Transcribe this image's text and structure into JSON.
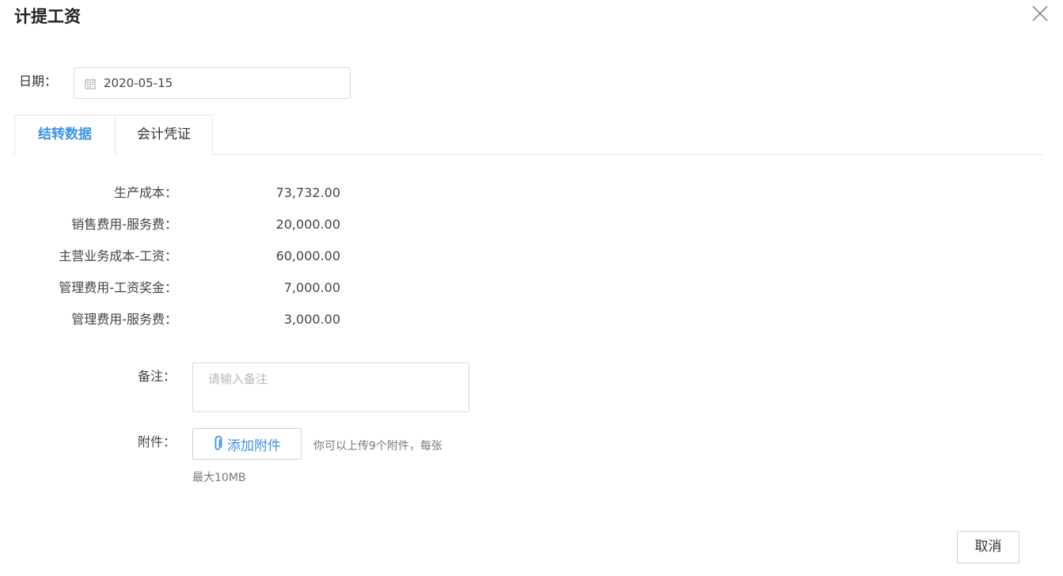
{
  "dialog": {
    "title": "计提工资",
    "close_icon": "close-icon"
  },
  "date": {
    "label": "日期：",
    "value": "2020-05-15",
    "icon": "calendar-icon"
  },
  "tabs": [
    {
      "label": "结转数据",
      "active": true
    },
    {
      "label": "会计凭证",
      "active": false
    }
  ],
  "rows": [
    {
      "label": "生产成本：",
      "value": "73,732.00"
    },
    {
      "label": "销售费用-服务费：",
      "value": "20,000.00"
    },
    {
      "label": "主营业务成本-工资：",
      "value": "60,000.00"
    },
    {
      "label": "管理费用-工资奖金：",
      "value": "7,000.00"
    },
    {
      "label": "管理费用-服务费：",
      "value": "3,000.00"
    }
  ],
  "remark": {
    "label": "备注：",
    "placeholder": "请输入备注",
    "value": ""
  },
  "attachment": {
    "label": "附件：",
    "button_label": "添加附件",
    "icon": "paperclip-icon",
    "hint_line1": "你可以上传9个附件，每张",
    "hint_line2": "最大10MB"
  },
  "footer": {
    "cancel_label": "取消"
  },
  "colors": {
    "accent": "#3a93e4",
    "border": "#d9d9d9",
    "text": "#333333",
    "muted": "#777777"
  }
}
